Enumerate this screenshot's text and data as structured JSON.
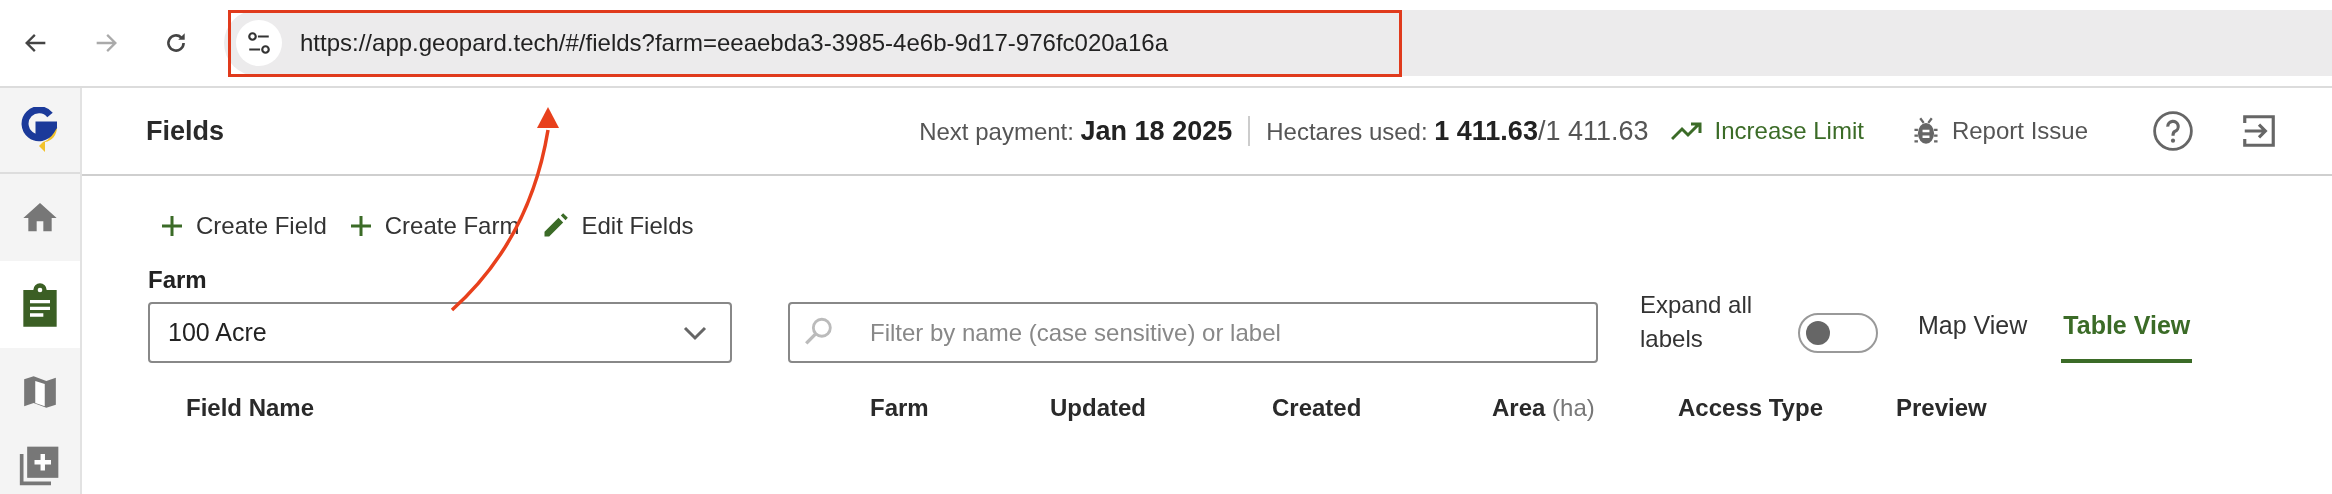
{
  "browser": {
    "back": {
      "disabled": false
    },
    "forward": {
      "disabled": true
    },
    "url": "https://app.geopard.tech/#/fields?farm=eeaebda3-3985-4e6b-9d17-976fc020a16a"
  },
  "sidebar": [
    {
      "kind": "home",
      "selected": false
    },
    {
      "kind": "fields",
      "selected": true
    },
    {
      "kind": "map",
      "selected": false
    },
    {
      "kind": "add",
      "selected": false
    }
  ],
  "header": {
    "title": "Fields",
    "next_payment_label": "Next payment:",
    "next_payment": "Jan 18 2025",
    "hectares_label": "Hectares used:",
    "hectares_used": "1 411.63",
    "hectares_limit": "/1 411.63",
    "actions": [
      {
        "kind": "increase",
        "label": "Increase Limit"
      },
      {
        "kind": "report",
        "label": "Report Issue"
      },
      {
        "kind": "help"
      },
      {
        "kind": "exit"
      }
    ]
  },
  "toolbar": [
    {
      "kind": "plus",
      "label": "Create Field"
    },
    {
      "kind": "plus",
      "label": "Create Farm"
    },
    {
      "kind": "pencil",
      "label": "Edit Fields"
    }
  ],
  "filters": {
    "farm_label": "Farm",
    "farm_value": "100 Acre",
    "search_placeholder": "Filter by name (case sensitive) or label",
    "expand_label": "Expand all labels",
    "expand_on": false,
    "views": [
      {
        "label": "Map View",
        "selected": false
      },
      {
        "label": "Table View",
        "selected": true
      }
    ]
  },
  "table": {
    "columns": [
      {
        "label": "Field Name"
      },
      {
        "label": "Farm"
      },
      {
        "label": "Updated"
      },
      {
        "label": "Created"
      },
      {
        "label": "Area",
        "unit": "(ha)"
      },
      {
        "label": "Access Type"
      },
      {
        "label": "Preview"
      }
    ]
  }
}
